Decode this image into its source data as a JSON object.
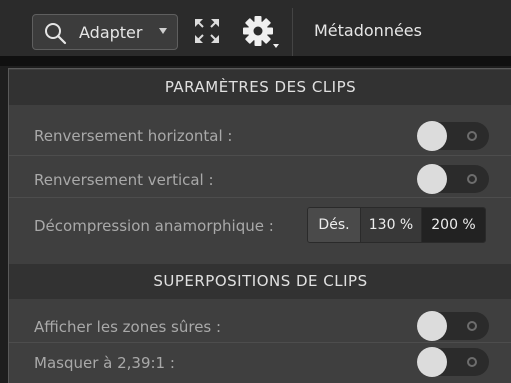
{
  "toolbar": {
    "zoom_select_value": "Adapter",
    "metadata_tab_label": "Métadonnées",
    "icons": [
      "search-icon",
      "fullscreen-icon",
      "gear-icon"
    ]
  },
  "clip_settings": {
    "header": "PARAMÈTRES DES CLIPS",
    "horizontal_flip_label": "Renversement horizontal :",
    "vertical_flip_label": "Renversement vertical :",
    "anamorphic_label": "Décompression anamorphique :",
    "anamorphic_options": [
      "Dés.",
      "130 %",
      "200 %"
    ],
    "horizontal_flip_on": false,
    "vertical_flip_on": false
  },
  "clip_overlays": {
    "header": "SUPERPOSITIONS DE CLIPS",
    "safe_zones_label": "Afficher les zones sûres :",
    "mask_label": "Masquer à 2,39:1 :",
    "safe_zones_on": false,
    "mask_on": false
  },
  "colors": {
    "panel_bg": "#3f3f3f",
    "header_bg": "#323232",
    "toolbar_bg": "#2b2b2b"
  }
}
